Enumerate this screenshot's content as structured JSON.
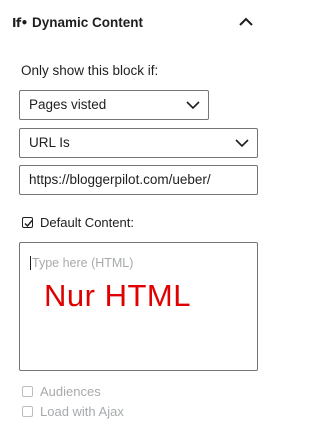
{
  "panel": {
    "logo": "If•",
    "title": "Dynamic Content",
    "collapse_icon": "chevron-up-icon"
  },
  "condition": {
    "label": "Only show this block if:",
    "source_select": "Pages visted",
    "operator_select": "URL Is",
    "url_value": "https://bloggerpilot.com/ueber/"
  },
  "default_content": {
    "checked": true,
    "label": "Default Content:",
    "placeholder": "Type here (HTML)",
    "annotation": "Nur HTML",
    "annotation_color": "#e00000"
  },
  "options": {
    "audiences_label": "Audiences",
    "ajax_label": "Load with Ajax"
  }
}
